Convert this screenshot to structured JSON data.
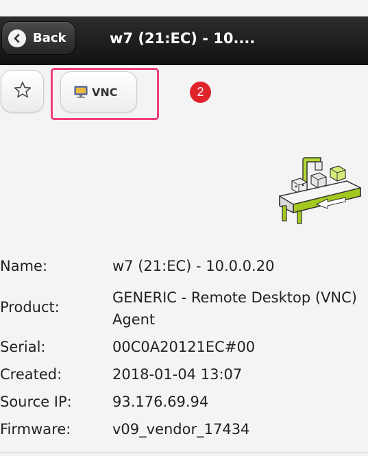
{
  "header": {
    "back_label": "Back",
    "title": "w7 (21:EC) - 10...."
  },
  "actions": {
    "favorite_icon": "star-outline-icon",
    "vnc_label": "VNC",
    "vnc_icon": "monitor-icon"
  },
  "badge": {
    "count": "2",
    "color": "#e0242b"
  },
  "details": {
    "name_label": "Name:",
    "name_value": "w7 (21:EC) - 10.0.0.20",
    "product_label": "Product:",
    "product_value_line1": "GENERIC - Remote Desktop (VNC)",
    "product_value_line2": "Agent",
    "serial_label": "Serial:",
    "serial_value": "00C0A20121EC#00",
    "created_label": "Created:",
    "created_value": "2018-01-04 13:07",
    "source_ip_label": "Source IP:",
    "source_ip_value": "93.176.69.94",
    "firmware_label": "Firmware:",
    "firmware_value": "v09_vendor_17434"
  },
  "colors": {
    "highlight": "#ef3f7a",
    "accent_green": "#a3c81e",
    "header_bg": "#1c1c1c"
  }
}
